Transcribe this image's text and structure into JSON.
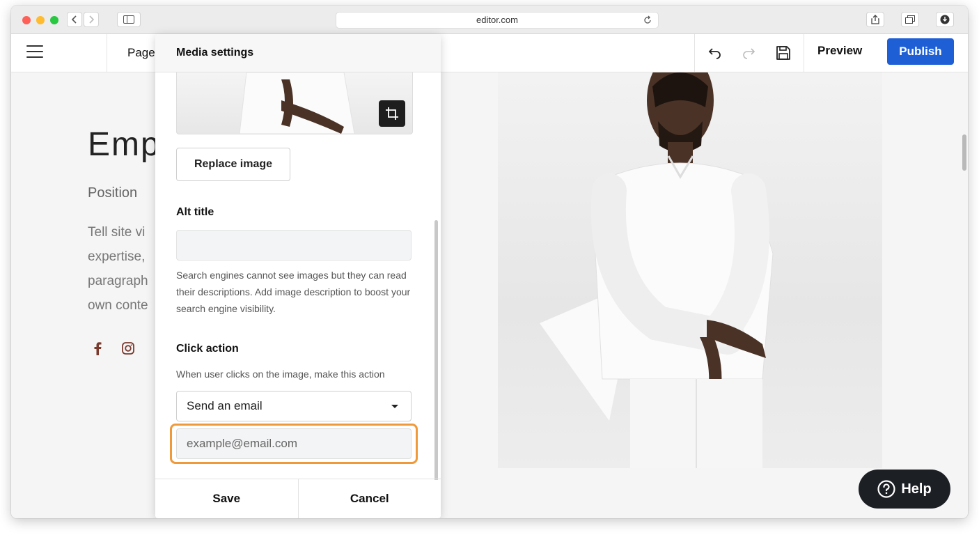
{
  "browser": {
    "url": "editor.com",
    "icons": [
      "back-icon",
      "forward-icon",
      "sidebar-icon",
      "reload-icon",
      "share-icon",
      "tabs-icon",
      "download-icon"
    ]
  },
  "toolbar": {
    "page_label": "Page",
    "preview_label": "Preview",
    "publish_label": "Publish",
    "icons": [
      "menu-icon",
      "undo-icon",
      "redo-icon",
      "save-icon"
    ]
  },
  "page": {
    "name_partial": "Emp",
    "position": "Position",
    "bio_lines": [
      "Tell site vi",
      "expertise,",
      "paragraph",
      "own conte"
    ],
    "social_icons": [
      "facebook-icon",
      "instagram-icon"
    ],
    "help_label": "Help"
  },
  "panel": {
    "title": "Media settings",
    "replace_label": "Replace image",
    "alt_title_label": "Alt title",
    "alt_value": "",
    "alt_hint": "Search engines cannot see images but they can read their descriptions. Add image description to boost your search engine visibility.",
    "click_action_label": "Click action",
    "click_action_hint": "When user clicks on the image, make this action",
    "click_action_value": "Send an email",
    "email_placeholder": "example@email.com",
    "save_label": "Save",
    "cancel_label": "Cancel"
  },
  "colors": {
    "publish": "#1f5fd6",
    "highlight": "#f0993a",
    "help_bg": "#1c1f24"
  }
}
